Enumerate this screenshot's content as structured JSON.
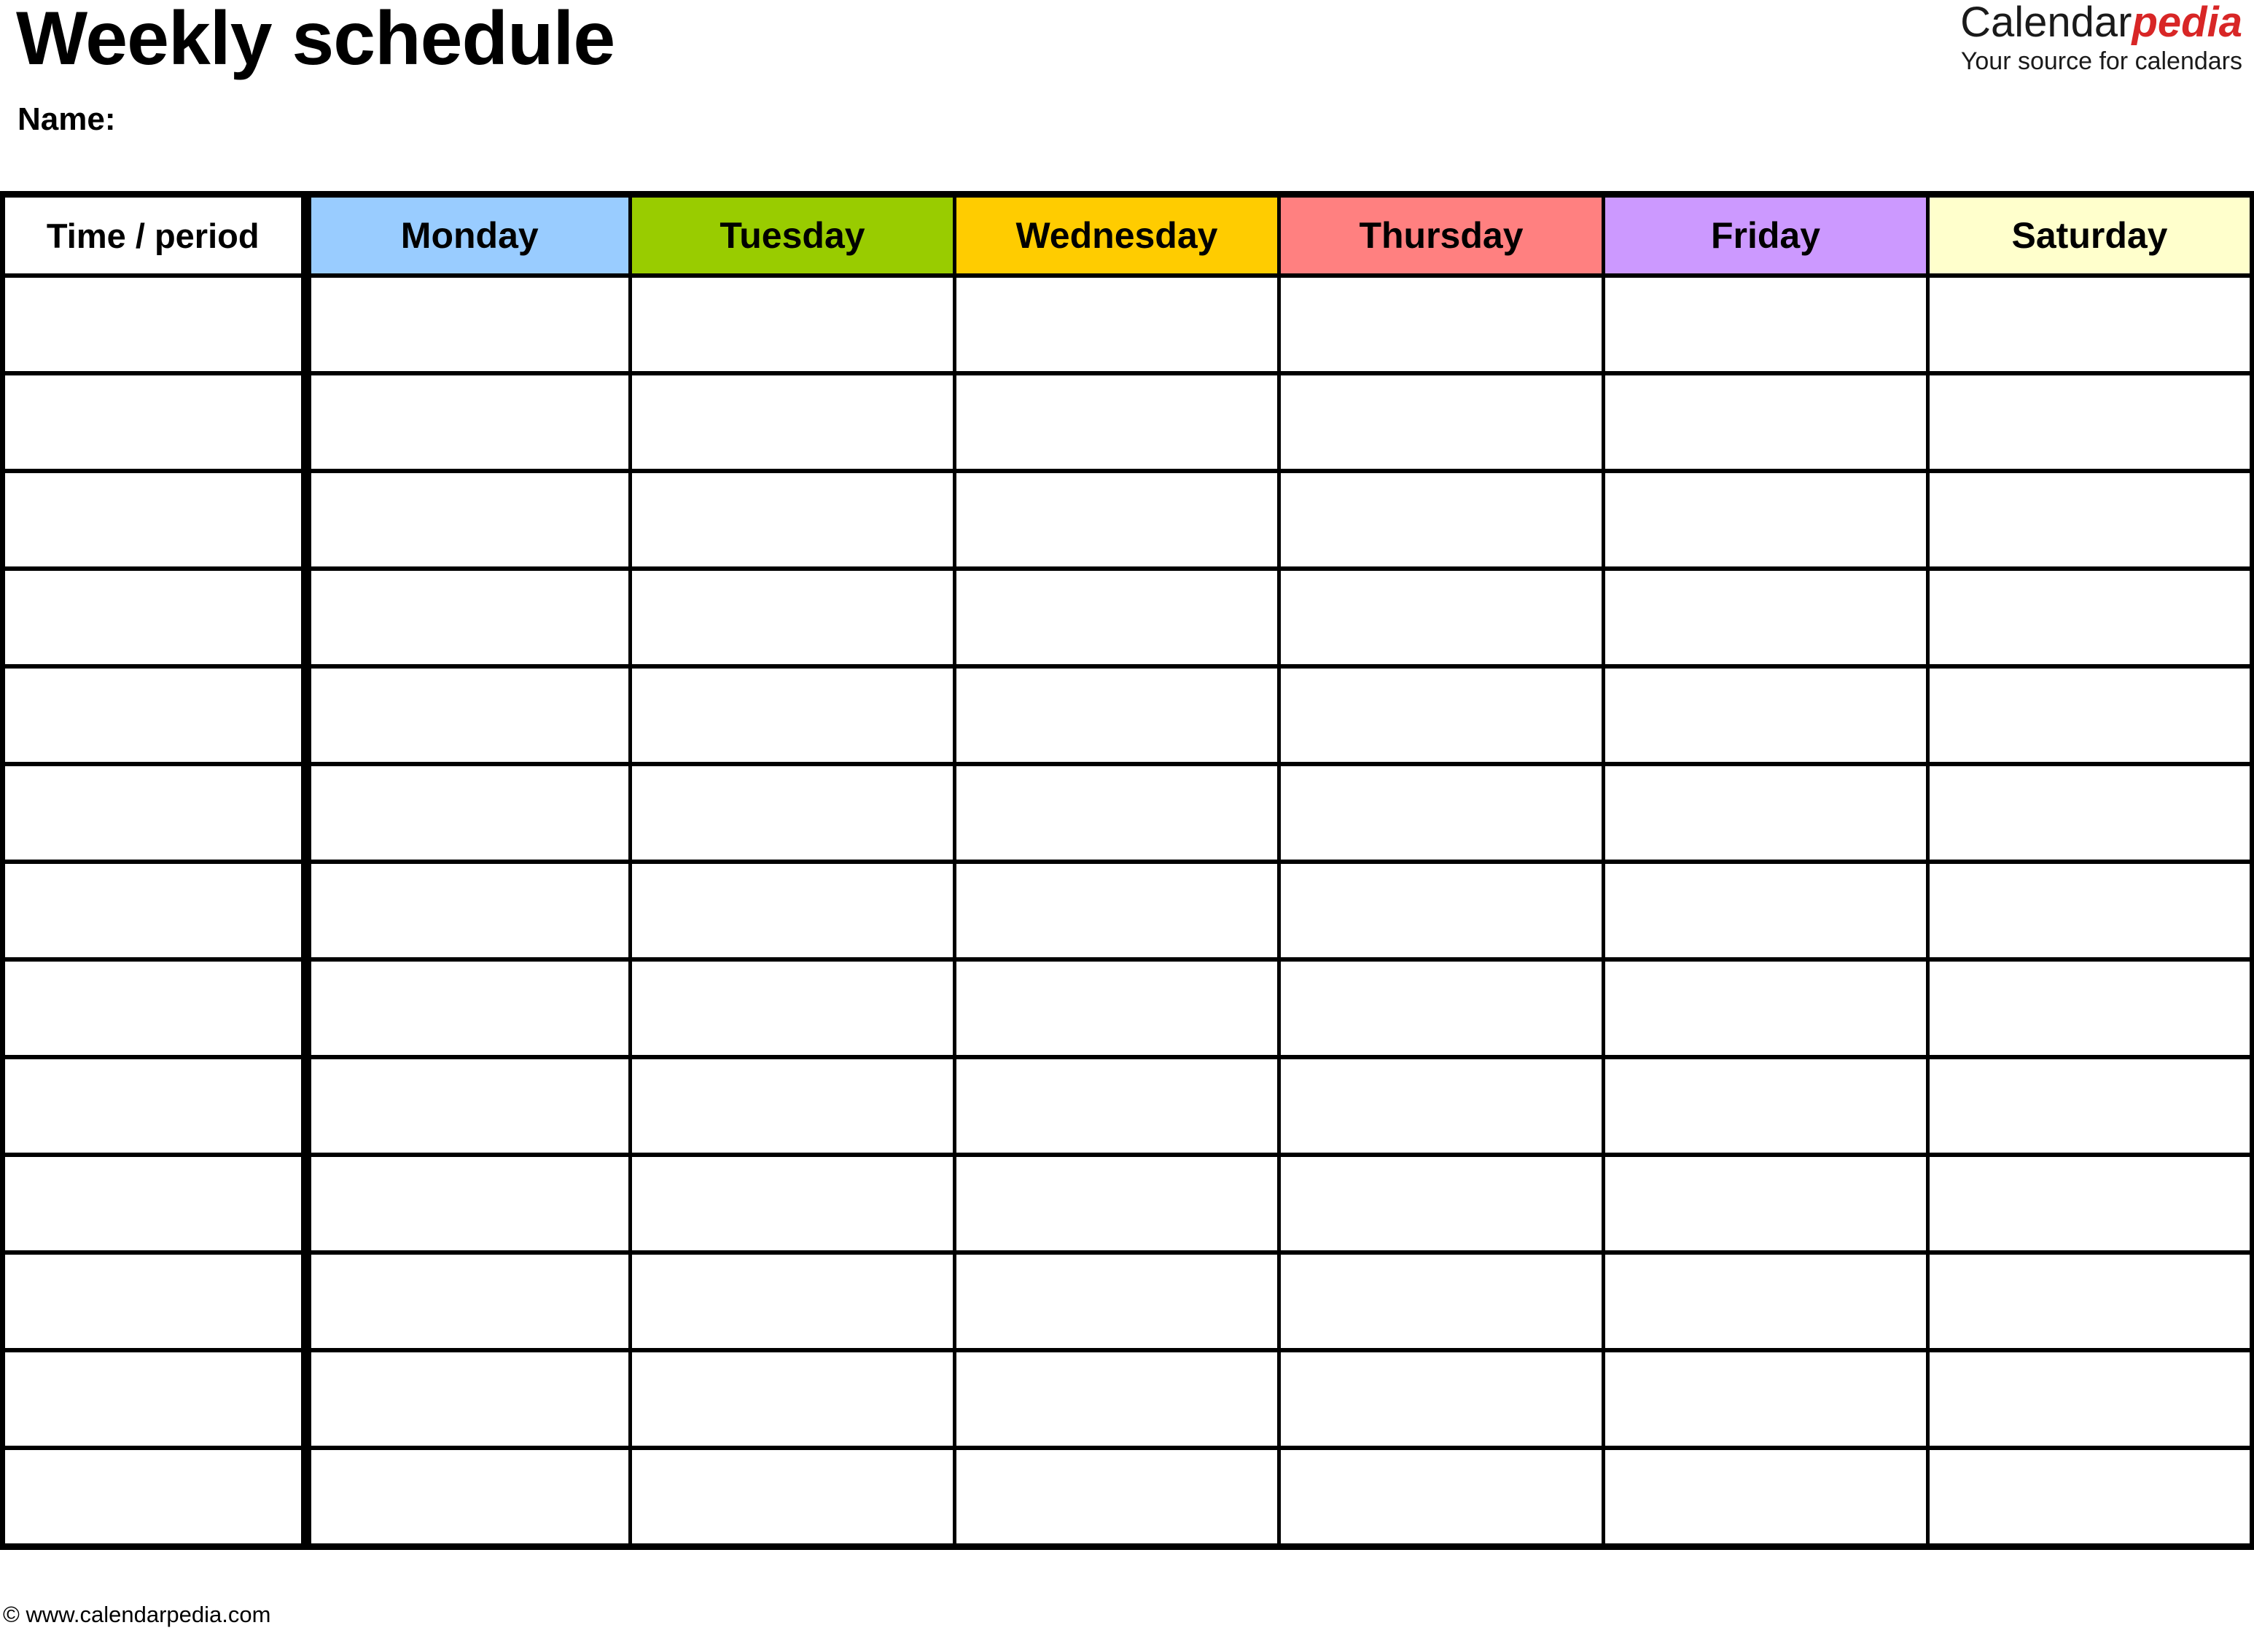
{
  "document": {
    "title": "Weekly schedule",
    "name_label": "Name:"
  },
  "brand": {
    "part1": "Calendar",
    "part2": "pedia",
    "tagline": "Your source for calendars",
    "accent_color": "#d82626",
    "text_color": "#1a1a1a"
  },
  "table": {
    "time_column_header": "Time / period",
    "columns": [
      {
        "label": "Monday",
        "color": "#99ccff"
      },
      {
        "label": "Tuesday",
        "color": "#99cc00"
      },
      {
        "label": "Wednesday",
        "color": "#ffcc00"
      },
      {
        "label": "Thursday",
        "color": "#ff8080"
      },
      {
        "label": "Friday",
        "color": "#cc99ff"
      },
      {
        "label": "Saturday",
        "color": "#ffffcc"
      }
    ],
    "row_count": 13,
    "rows": [
      {
        "time": "",
        "cells": [
          "",
          "",
          "",
          "",
          "",
          ""
        ]
      },
      {
        "time": "",
        "cells": [
          "",
          "",
          "",
          "",
          "",
          ""
        ]
      },
      {
        "time": "",
        "cells": [
          "",
          "",
          "",
          "",
          "",
          ""
        ]
      },
      {
        "time": "",
        "cells": [
          "",
          "",
          "",
          "",
          "",
          ""
        ]
      },
      {
        "time": "",
        "cells": [
          "",
          "",
          "",
          "",
          "",
          ""
        ]
      },
      {
        "time": "",
        "cells": [
          "",
          "",
          "",
          "",
          "",
          ""
        ]
      },
      {
        "time": "",
        "cells": [
          "",
          "",
          "",
          "",
          "",
          ""
        ]
      },
      {
        "time": "",
        "cells": [
          "",
          "",
          "",
          "",
          "",
          ""
        ]
      },
      {
        "time": "",
        "cells": [
          "",
          "",
          "",
          "",
          "",
          ""
        ]
      },
      {
        "time": "",
        "cells": [
          "",
          "",
          "",
          "",
          "",
          ""
        ]
      },
      {
        "time": "",
        "cells": [
          "",
          "",
          "",
          "",
          "",
          ""
        ]
      },
      {
        "time": "",
        "cells": [
          "",
          "",
          "",
          "",
          "",
          ""
        ]
      },
      {
        "time": "",
        "cells": [
          "",
          "",
          "",
          "",
          "",
          ""
        ]
      }
    ]
  },
  "footer": {
    "copyright": "© www.calendarpedia.com"
  }
}
